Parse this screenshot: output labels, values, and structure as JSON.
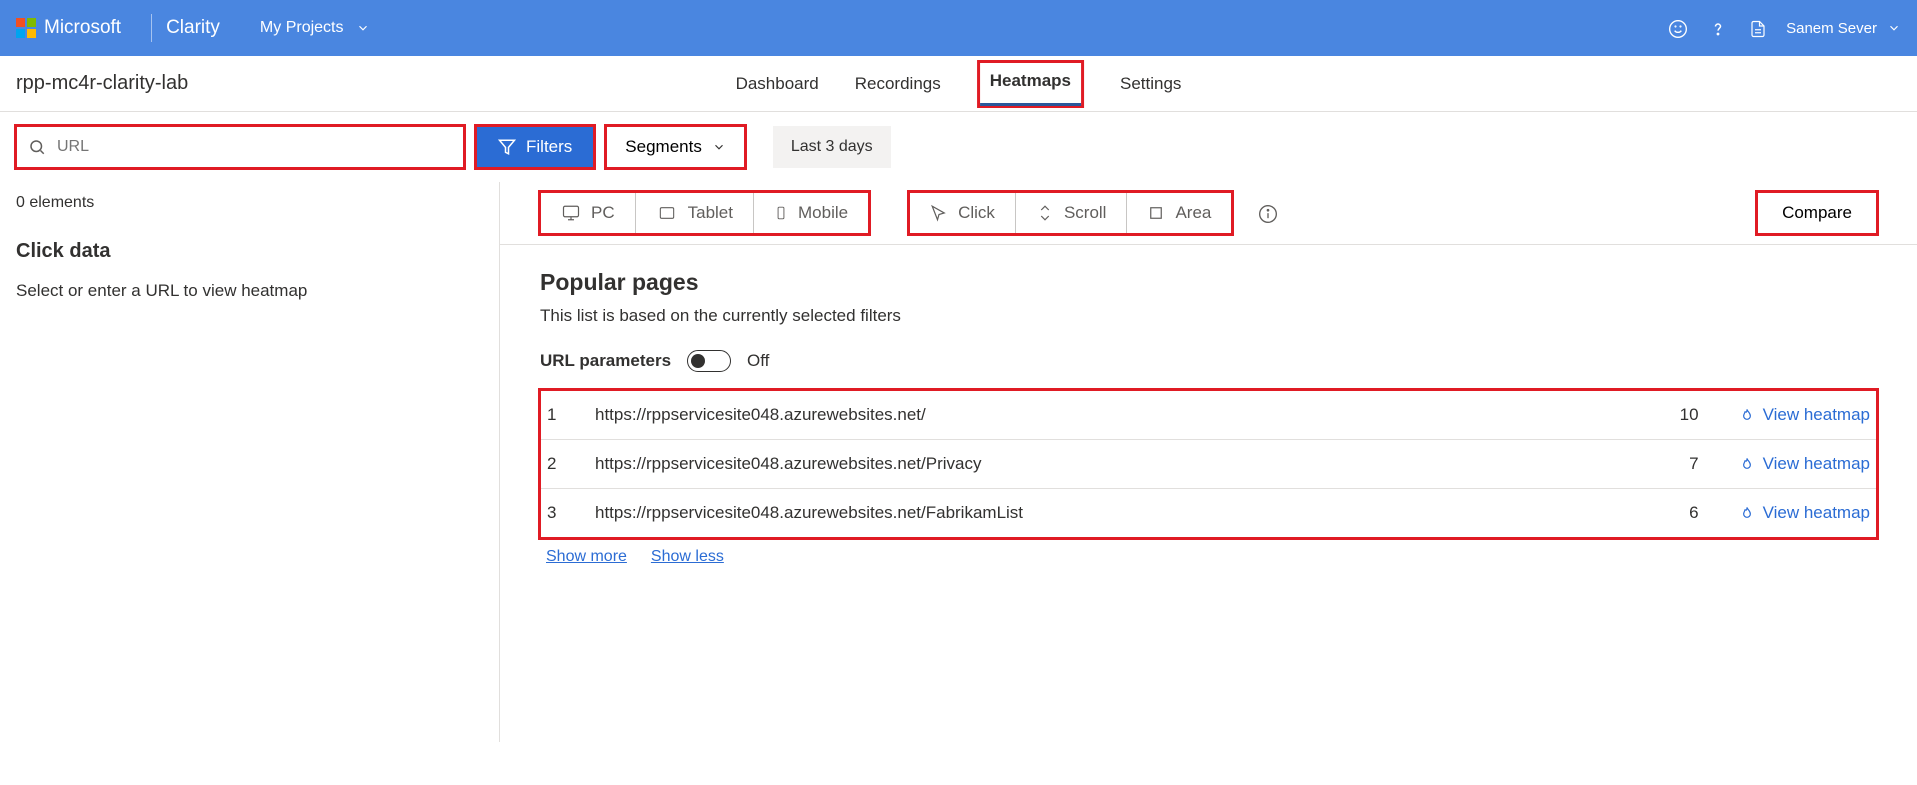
{
  "header": {
    "brand_ms": "Microsoft",
    "brand_product": "Clarity",
    "my_projects": "My Projects",
    "user_name": "Sanem Sever"
  },
  "subheader": {
    "project": "rpp-mc4r-clarity-lab",
    "tabs": {
      "dashboard": "Dashboard",
      "recordings": "Recordings",
      "heatmaps": "Heatmaps",
      "settings": "Settings"
    }
  },
  "filterbar": {
    "url_placeholder": "URL",
    "filters": "Filters",
    "segments": "Segments",
    "date": "Last 3 days"
  },
  "sidebar": {
    "elements_count": "0 elements",
    "click_data": "Click data",
    "hint": "Select or enter a URL to view heatmap"
  },
  "toolbar": {
    "devices": {
      "pc": "PC",
      "tablet": "Tablet",
      "mobile": "Mobile"
    },
    "modes": {
      "click": "Click",
      "scroll": "Scroll",
      "area": "Area"
    },
    "compare": "Compare"
  },
  "popular": {
    "title": "Popular pages",
    "subtitle": "This list is based on the currently selected filters",
    "url_params_label": "URL parameters",
    "url_params_state": "Off",
    "view_heatmap": "View heatmap",
    "rows": [
      {
        "n": "1",
        "url": "https://rppservicesite048.azurewebsites.net/",
        "count": "10"
      },
      {
        "n": "2",
        "url": "https://rppservicesite048.azurewebsites.net/Privacy",
        "count": "7"
      },
      {
        "n": "3",
        "url": "https://rppservicesite048.azurewebsites.net/FabrikamList",
        "count": "6"
      }
    ],
    "show_more": "Show more",
    "show_less": "Show less"
  }
}
